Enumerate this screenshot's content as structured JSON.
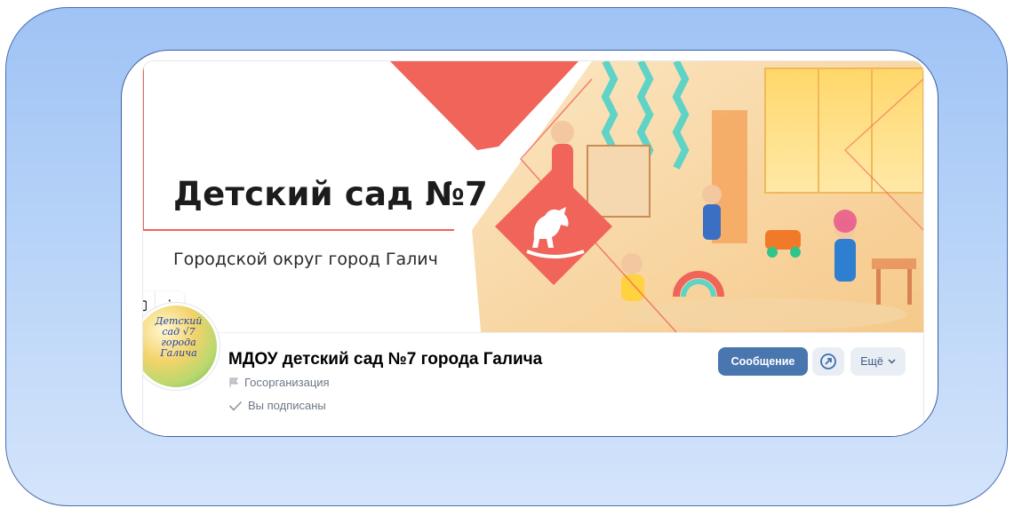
{
  "cover": {
    "title": "Детский сад №7",
    "subtitle": "Городской округ город Галич"
  },
  "tools": {
    "camera_icon": "camera-icon",
    "more_icon": "⋮"
  },
  "avatar": {
    "text": "Детский\nсад √7\nгорода\nГалича"
  },
  "group": {
    "name": "МДОУ детский сад №7 города Галича",
    "type": "Госорганизация",
    "subscription_status": "Вы подписаны"
  },
  "actions": {
    "message_label": "Сообщение",
    "more_label": "Ещё"
  },
  "colors": {
    "accent": "#f0645a",
    "primary_button": "#4a76b0"
  }
}
